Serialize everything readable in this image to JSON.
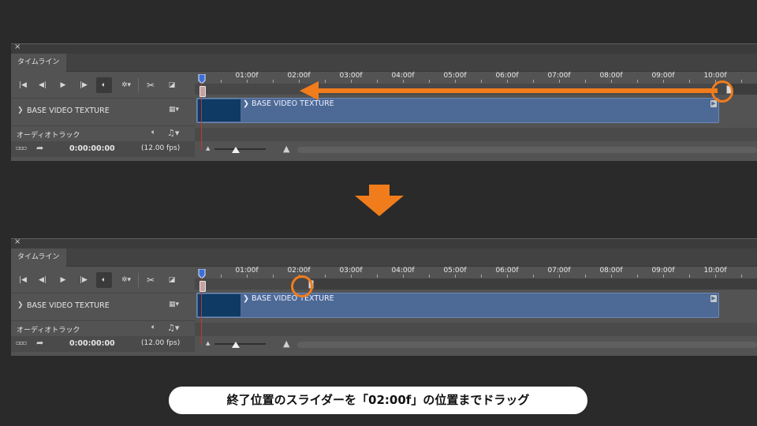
{
  "tab_label": "タイムライン",
  "close_glyph": "×",
  "video_track_name": "BASE VIDEO TEXTURE",
  "audio_track_name": "オーディオトラック",
  "clip_name": "BASE VIDEO TEXTURE",
  "timecode": "0:00:00:00",
  "fps": "(12.00 fps)",
  "ruler": [
    "01:00f",
    "02:00f",
    "03:00f",
    "04:00f",
    "05:00f",
    "06:00f",
    "07:00f",
    "08:00f",
    "09:00f",
    "10:00f"
  ],
  "before": {
    "work_area_end": "10:00f"
  },
  "after": {
    "work_area_end": "02:00f"
  },
  "caption": "終了位置のスライダーを「02:00f」の位置までドラッグ",
  "colors": {
    "accent": "#f07c1c",
    "clip": "#4d6a96",
    "playhead": "#c0392b"
  },
  "icons": [
    "go-to-first-frame-icon",
    "previous-frame-icon",
    "play-icon",
    "next-frame-icon",
    "audio-icon",
    "settings-icon",
    "split-icon",
    "transition-icon",
    "film-icon",
    "music-icon",
    "render-icon",
    "arrow-icon",
    "zoom-out-icon",
    "zoom-in-icon"
  ]
}
